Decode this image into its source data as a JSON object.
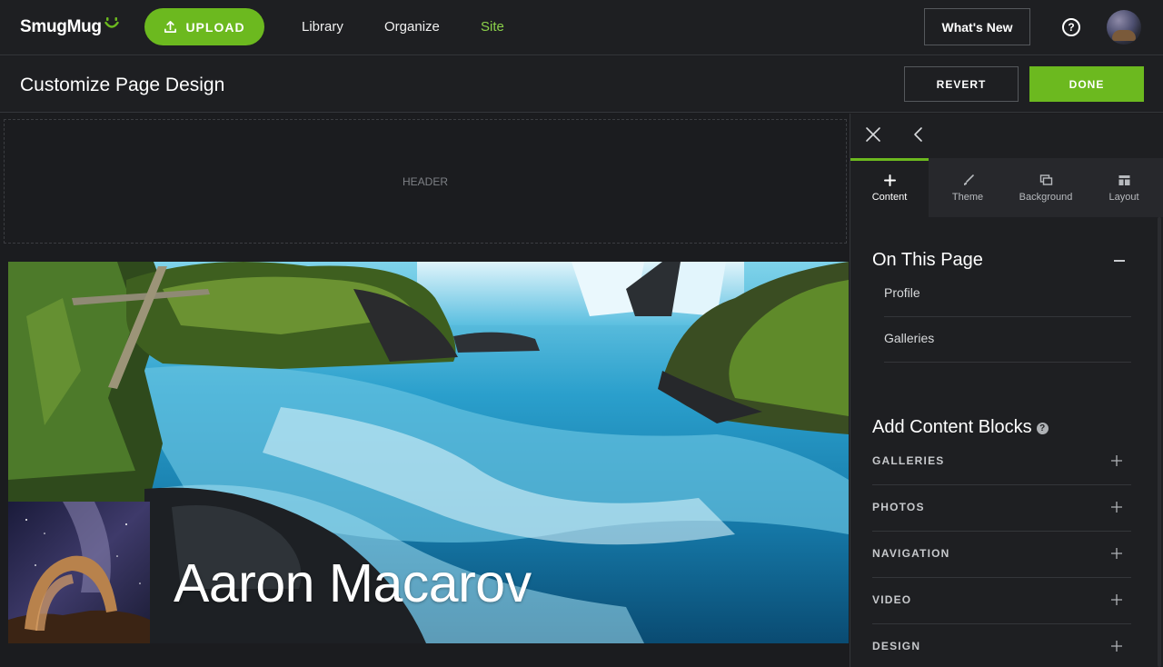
{
  "topbar": {
    "logo": "SmugMug",
    "upload_label": "UPLOAD",
    "nav": [
      "Library",
      "Organize",
      "Site"
    ],
    "active_nav": "Site",
    "whats_new_label": "What's New",
    "help_icon": "?",
    "accent_color": "#6cb91f"
  },
  "subheader": {
    "title": "Customize Page Design",
    "revert_label": "REVERT",
    "done_label": "DONE"
  },
  "canvas": {
    "header_placeholder": "HEADER",
    "hero_name": "Aaron Macarov"
  },
  "panel": {
    "tabs": [
      {
        "label": "Content",
        "icon": "plus-icon",
        "active": true
      },
      {
        "label": "Theme",
        "icon": "brush-icon",
        "active": false
      },
      {
        "label": "Background",
        "icon": "background-icon",
        "active": false
      },
      {
        "label": "Layout",
        "icon": "layout-icon",
        "active": false
      }
    ],
    "on_this_page": {
      "title": "On This Page",
      "items": [
        "Profile",
        "Galleries"
      ]
    },
    "add_blocks": {
      "title": "Add Content Blocks",
      "help_glyph": "?",
      "items": [
        "GALLERIES",
        "PHOTOS",
        "NAVIGATION",
        "VIDEO",
        "DESIGN"
      ]
    }
  }
}
